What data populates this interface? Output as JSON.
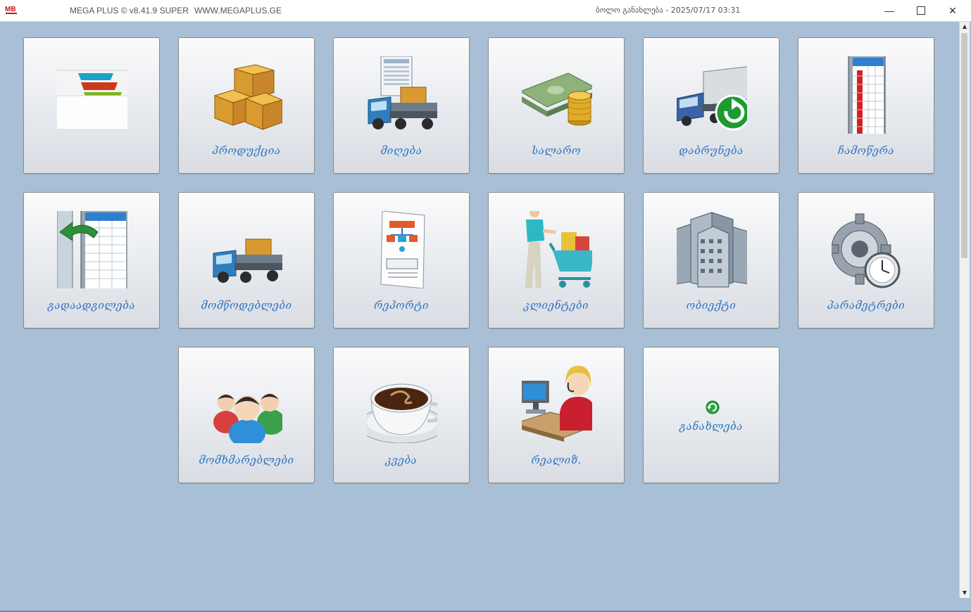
{
  "titlebar": {
    "app_name": "MEGA PLUS  ©  v8.41.9 SUPER",
    "app_url": "WWW.MEGAPLUS.GE",
    "last_update": "ბოლო განახლება - 2025/07/17 03:31",
    "minimize_icon": "minimize-icon",
    "maximize_icon": "maximize-icon",
    "close_icon": "close-icon"
  },
  "tiles": [
    {
      "label": "",
      "icon": "folders-icon"
    },
    {
      "label": "პროდუქცია",
      "icon": "boxes-icon"
    },
    {
      "label": "მიღება",
      "icon": "truck-invoice-icon"
    },
    {
      "label": "სალარო",
      "icon": "money-icon"
    },
    {
      "label": "დაბრუნება",
      "icon": "truck-return-icon"
    },
    {
      "label": "ჩამოწერა",
      "icon": "writeoff-table-icon"
    },
    {
      "label": "გადაადგილება",
      "icon": "transfer-table-icon"
    },
    {
      "label": "მომწოდებლები",
      "icon": "supplier-truck-icon"
    },
    {
      "label": "რეპორტი",
      "icon": "report-icon"
    },
    {
      "label": "კლიენტები",
      "icon": "shopping-cart-icon"
    },
    {
      "label": "ობიექტი",
      "icon": "buildings-icon"
    },
    {
      "label": "პარამეტრები",
      "icon": "gear-clock-icon"
    },
    {
      "label": "მომხმარებლები",
      "icon": "users-icon"
    },
    {
      "label": "კვება",
      "icon": "coffee-icon"
    },
    {
      "label": "რეალიზ.",
      "icon": "cashier-icon"
    },
    {
      "label": "განახლება",
      "icon": "refresh-icon"
    }
  ]
}
